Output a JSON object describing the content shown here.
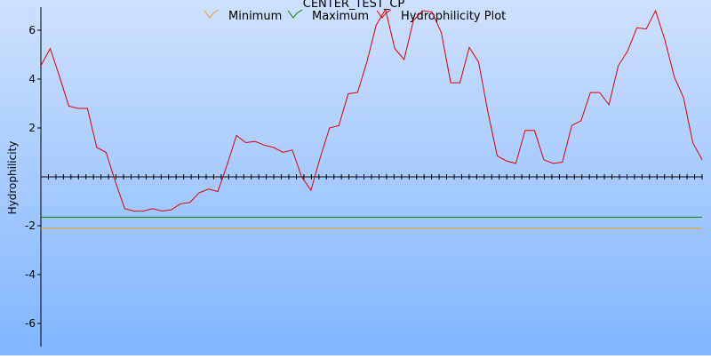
{
  "chart_data": {
    "type": "line",
    "title": "CENTER_TEST_CP",
    "xlabel": "",
    "ylabel": "Hydrophilicity",
    "ylim": [
      -7,
      7
    ],
    "y_ticks": [
      6,
      4,
      2,
      -2,
      -4,
      -6
    ],
    "grid": false,
    "legend": {
      "placement": "top-center",
      "entries": [
        "Minimum",
        "Maximum",
        "Hydrophilicity Plot"
      ]
    },
    "colors": {
      "background_top": "#cfe0ff",
      "background_bottom": "#7fb6ff",
      "axis": "#000000",
      "minimum": "#f0a020",
      "maximum": "#008000",
      "plot": "#e00000"
    },
    "x": [
      1,
      2,
      3,
      4,
      5,
      6,
      7,
      8,
      9,
      10,
      11,
      12,
      13,
      14,
      15,
      16,
      17,
      18,
      19,
      20,
      21,
      22,
      23,
      24,
      25,
      26,
      27,
      28,
      29,
      30,
      31,
      32,
      33,
      34,
      35,
      36,
      37,
      38,
      39,
      40,
      41,
      42,
      43,
      44,
      45,
      46,
      47,
      48,
      49,
      50,
      51,
      52,
      53,
      54,
      55,
      56,
      57,
      58,
      59,
      60,
      61,
      62,
      63,
      64,
      65,
      66,
      67,
      68,
      69,
      70,
      71,
      72,
      73,
      74,
      75,
      76,
      77,
      78,
      79,
      80,
      81,
      82,
      83,
      84,
      85,
      86,
      87,
      88,
      89
    ],
    "series": [
      {
        "name": "Minimum",
        "values": [
          -2.1,
          -2.1
        ]
      },
      {
        "name": "Maximum",
        "values": [
          -1.65,
          -1.65
        ]
      },
      {
        "name": "Hydrophilicity Plot",
        "values": [
          4.55,
          5.25,
          4.1,
          2.9,
          2.8,
          2.8,
          1.2,
          1.0,
          -0.2,
          -1.3,
          -1.4,
          -1.4,
          -1.3,
          -1.4,
          -1.35,
          -1.1,
          -1.05,
          -0.65,
          -0.5,
          -0.6,
          0.5,
          1.7,
          1.4,
          1.45,
          1.3,
          1.2,
          1.0,
          1.1,
          0.0,
          -0.55,
          0.8,
          2.0,
          2.1,
          3.4,
          3.45,
          4.7,
          6.2,
          6.85,
          5.25,
          4.8,
          6.4,
          6.8,
          6.75,
          5.9,
          3.85,
          3.85,
          5.3,
          4.7,
          2.65,
          0.85,
          0.65,
          0.55,
          1.9,
          1.9,
          0.7,
          0.55,
          0.6,
          2.1,
          2.3,
          3.45,
          3.45,
          2.95,
          4.55,
          5.15,
          6.1,
          6.05,
          6.8,
          5.6,
          4.1,
          3.25,
          1.4,
          0.7
        ]
      }
    ]
  }
}
